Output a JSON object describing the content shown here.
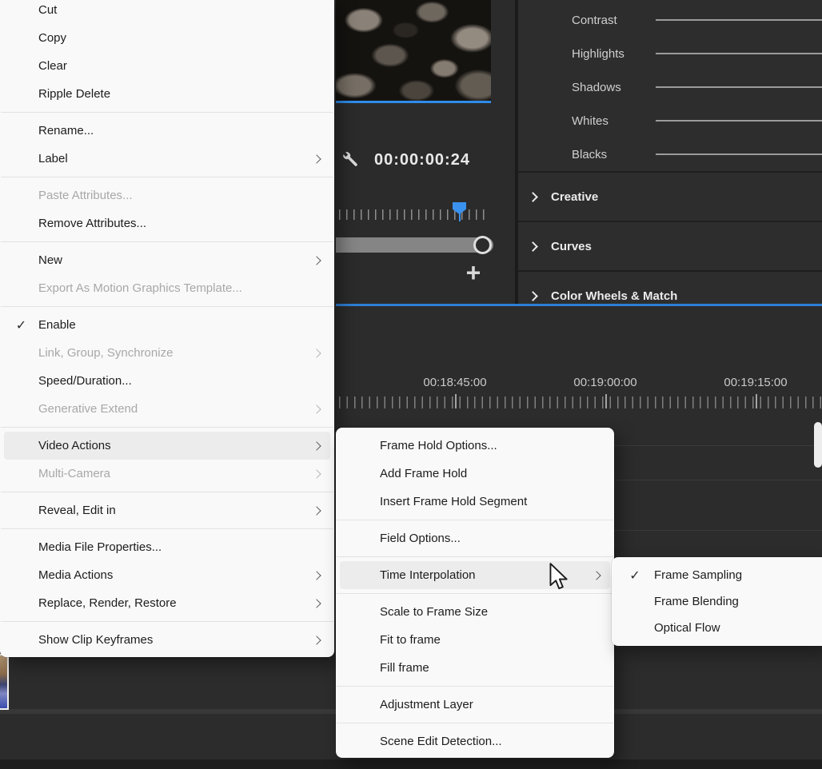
{
  "app": "Adobe Premiere Pro",
  "colors": {
    "accent_blue": "#2e8ceb",
    "menu_background": "#f9f9f9",
    "menu_highlight": "#ececec",
    "panel_dark": "#2d2d2d",
    "timeline_dark": "#2c2c2c"
  },
  "menus": {
    "main": {
      "items": [
        "Cut",
        "Copy",
        "Clear",
        "Ripple Delete",
        "Rename...",
        "Label",
        "Paste Attributes...",
        "Remove Attributes...",
        "New",
        "Export As Motion Graphics Template...",
        "Enable",
        "Link, Group, Synchronize",
        "Speed/Duration...",
        "Generative Extend",
        "Video Actions",
        "Multi-Camera",
        "Reveal, Edit in",
        "Media File Properties...",
        "Media Actions",
        "Replace, Render, Restore",
        "Show Clip Keyframes"
      ],
      "checked_item": "Enable",
      "highlighted_item": "Video Actions",
      "disabled_items": [
        "Paste Attributes...",
        "Export As Motion Graphics Template...",
        "Link, Group, Synchronize",
        "Generative Extend",
        "Multi-Camera"
      ],
      "check_glyph": "✓"
    },
    "video_actions": {
      "items": [
        "Frame Hold Options...",
        "Add Frame Hold",
        "Insert Frame Hold Segment",
        "Field Options...",
        "Time Interpolation",
        "Scale to Frame Size",
        "Fit to frame",
        "Fill frame",
        "Adjustment Layer",
        "Scene Edit Detection..."
      ],
      "highlighted_item": "Time Interpolation"
    },
    "time_interpolation": {
      "items": [
        "Frame Sampling",
        "Frame Blending",
        "Optical Flow"
      ],
      "checked_item": "Frame Sampling",
      "check_glyph": "✓"
    }
  },
  "program_monitor": {
    "timecode": "00:00:00:24",
    "add_button_glyph": "+"
  },
  "lumetri": {
    "sliders": [
      "Contrast",
      "Highlights",
      "Shadows",
      "Whites",
      "Blacks"
    ],
    "sections": [
      "Creative",
      "Curves",
      "Color Wheels & Match"
    ]
  },
  "timeline": {
    "ruler_labels": [
      "00:18:45:00",
      "00:19:00:00",
      "00:19:15:00"
    ]
  }
}
